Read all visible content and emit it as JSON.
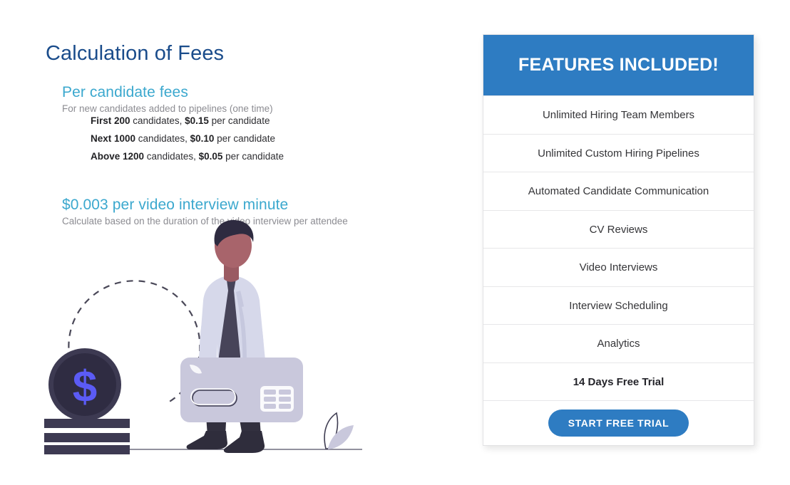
{
  "page": {
    "title": "Calculation of Fees",
    "title_color": "#1a4c8b",
    "accent_color": "#3ba8ce",
    "brand_blue": "#2e7cc2"
  },
  "per_candidate": {
    "heading": "Per candidate fees",
    "subtitle": "For new candidates added to pipelines (one time)",
    "tiers": [
      {
        "tier": "First 200",
        "middle": " candidates, ",
        "price": "$0.15",
        "suffix": " per candidate"
      },
      {
        "tier": "Next 1000",
        "middle": " candidates, ",
        "price": "$0.10",
        "suffix": " per candidate"
      },
      {
        "tier": "Above 1200",
        "middle": " candidates, ",
        "price": "$0.05",
        "suffix": " per candidate"
      }
    ]
  },
  "video_interview": {
    "heading": "$0.003 per video interview minute",
    "subtitle": "Calculate based on the duration of the video interview per attendee"
  },
  "illustration": {
    "name": "businessman-holding-credit-card-with-coin-stack",
    "coin_symbol": "$",
    "colors": {
      "coin_body": "#353149",
      "coin_symbol": "#5b5bf5",
      "coin_stack": "#3d3a52",
      "hair": "#2e2b40",
      "skin": "#a8646b",
      "shirt": "#d6d8ea",
      "tie": "#474459",
      "trousers": "#32303f",
      "shoes": "#2f2d3c",
      "card": "#c9c8dc",
      "leaf": "#c9c8dc",
      "dashed_arc": "#4a4858",
      "ground_line": "#6f6d7e"
    }
  },
  "features_card": {
    "header": "FEATURES INCLUDED!",
    "items": [
      {
        "label": "Unlimited Hiring Team Members",
        "bold": false
      },
      {
        "label": "Unlimited Custom Hiring Pipelines",
        "bold": false
      },
      {
        "label": "Automated Candidate Communication",
        "bold": false
      },
      {
        "label": "CV Reviews",
        "bold": false
      },
      {
        "label": "Video Interviews",
        "bold": false
      },
      {
        "label": "Interview Scheduling",
        "bold": false
      },
      {
        "label": "Analytics",
        "bold": false
      },
      {
        "label": "14 Days Free Trial",
        "bold": true
      }
    ],
    "cta_label": "START FREE TRIAL"
  }
}
